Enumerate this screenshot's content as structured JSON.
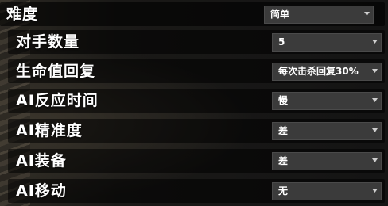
{
  "settings": [
    {
      "label": "难度",
      "value": "简单"
    },
    {
      "label": "对手数量",
      "value": "5"
    },
    {
      "label": "生命值回复",
      "value": "每次击杀回复30%"
    },
    {
      "label": "AI反应时间",
      "value": "慢"
    },
    {
      "label": "AI精准度",
      "value": "差"
    },
    {
      "label": "AI装备",
      "value": "差"
    },
    {
      "label": "AI移动",
      "value": "无"
    }
  ],
  "colors": {
    "row_background": "#000000",
    "dropdown_background": "#3b3b3b",
    "text": "#ffffff"
  },
  "icons": {
    "dropdown": "chevron-down-icon"
  }
}
